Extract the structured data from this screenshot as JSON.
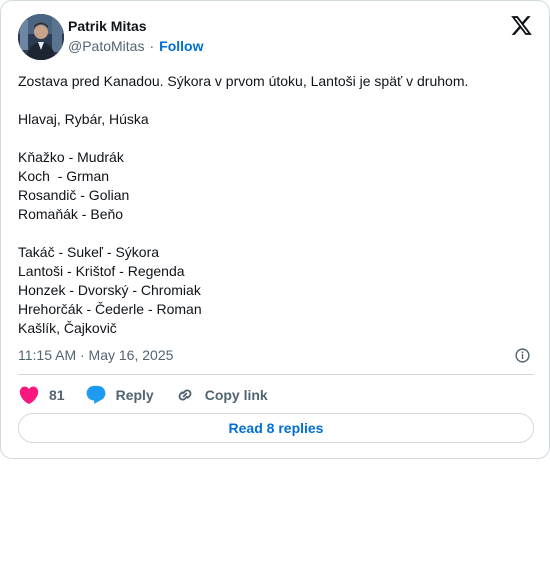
{
  "author": {
    "name": "Patrik Mitas",
    "handle": "@PatoMitas",
    "separator": "·",
    "follow_label": "Follow"
  },
  "tweet": {
    "lines": [
      "Zostava pred Kanadou. Sýkora v prvom útoku, Lantoši je späť v druhom.",
      "",
      "Hlavaj, Rybár, Húska",
      "",
      "Kňažko - Mudrák",
      "Koch  - Grman",
      "Rosandič - Golian",
      "Romaňák - Beňo",
      "",
      "Takáč - Sukeľ - Sýkora",
      "Lantoši - Krištof - Regenda",
      "Honzek - Dvorský - Chromiak",
      "Hrehorčák - Čederle - Roman",
      "Kašlík, Čajkovič"
    ],
    "timestamp": "11:15 AM · May 16, 2025"
  },
  "actions": {
    "like_count": "81",
    "reply_label": "Reply",
    "copy_link_label": "Copy link"
  },
  "footer": {
    "read_replies_label": "Read 8 replies"
  },
  "colors": {
    "accent": "#006fd6",
    "like": "#f91880",
    "reply": "#1d9bf0",
    "muted": "#536471",
    "border": "#cfd9de"
  },
  "icons": [
    "avatar-photo",
    "x-logo-icon",
    "info-icon",
    "heart-icon",
    "speech-bubble-icon",
    "link-icon"
  ]
}
